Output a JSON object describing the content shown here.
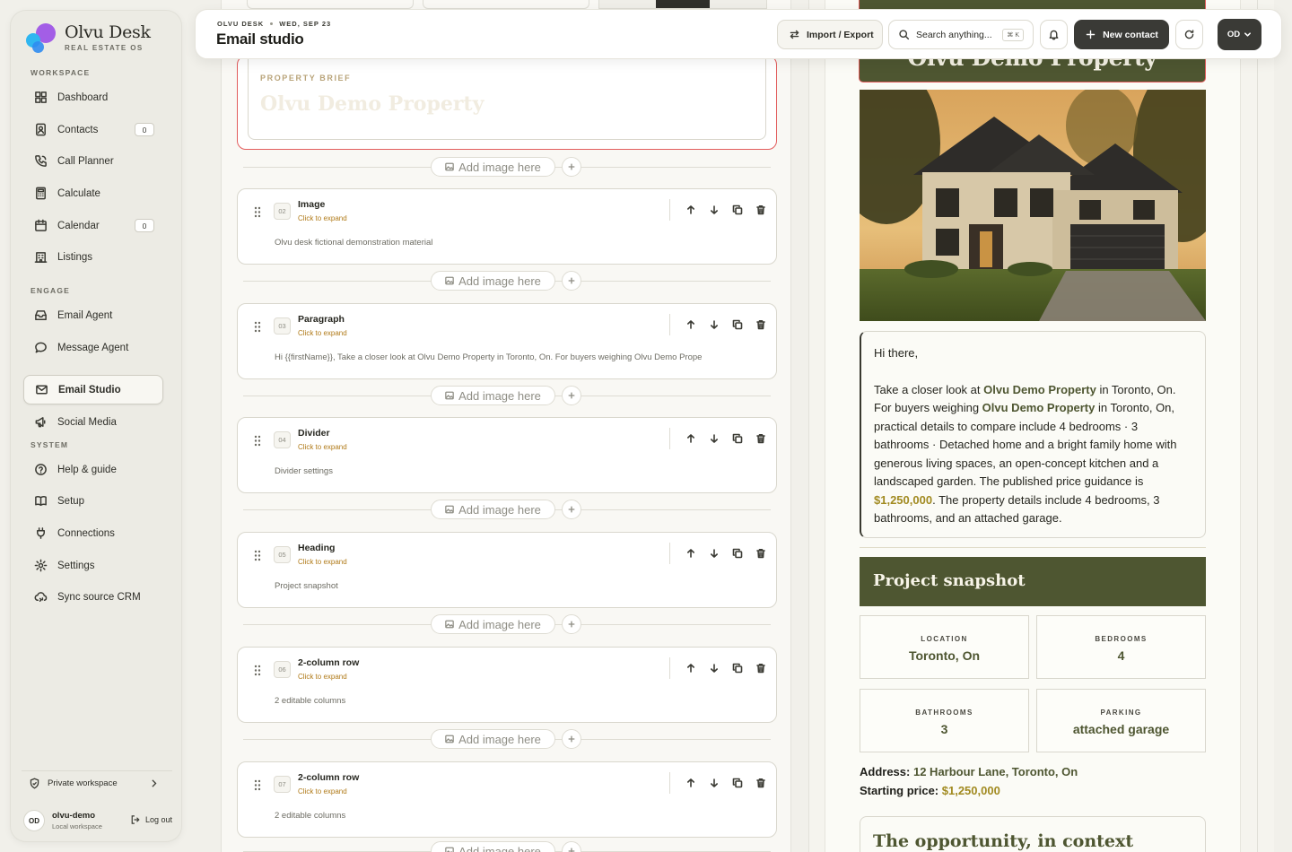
{
  "brand": {
    "name": "Olvu Desk",
    "subtitle": "REAL ESTATE OS"
  },
  "sidebar": {
    "sections": {
      "workspace": "WORKSPACE",
      "engage": "ENGAGE",
      "system": "SYSTEM"
    },
    "items": [
      {
        "label": "Dashboard",
        "icon": "dashboard-icon"
      },
      {
        "label": "Contacts",
        "icon": "contacts-icon",
        "badge": "0"
      },
      {
        "label": "Call Planner",
        "icon": "phone-icon"
      },
      {
        "label": "Calculate",
        "icon": "calculator-icon"
      },
      {
        "label": "Calendar",
        "icon": "calendar-icon",
        "badge": "0"
      },
      {
        "label": "Listings",
        "icon": "building-icon"
      },
      {
        "label": "Email Agent",
        "icon": "inbox-icon"
      },
      {
        "label": "Message Agent",
        "icon": "chat-icon"
      },
      {
        "label": "Email Studio",
        "icon": "mail-icon",
        "active": true
      },
      {
        "label": "Social Media",
        "icon": "megaphone-icon"
      },
      {
        "label": "Help & guide",
        "icon": "help-icon"
      },
      {
        "label": "Setup",
        "icon": "book-icon"
      },
      {
        "label": "Connections",
        "icon": "plug-icon"
      },
      {
        "label": "Settings",
        "icon": "gear-icon"
      },
      {
        "label": "Sync source CRM",
        "icon": "cloud-sync-icon"
      }
    ],
    "private_workspace": "Private workspace",
    "user": {
      "initials": "OD",
      "name": "olvu-demo",
      "sub": "Local workspace"
    },
    "logout": "Log out"
  },
  "topbar": {
    "crumb_app": "OLVU DESK",
    "crumb_date": "WED, SEP 23",
    "title": "Email studio",
    "import_export": "Import / Export",
    "search_placeholder": "Search anything...",
    "search_kbd": "⌘ K",
    "new_contact": "New contact",
    "avatar": "OD"
  },
  "editor": {
    "brief_label": "PROPERTY BRIEF",
    "brief_title": "Olvu Demo Property",
    "insert_label": "Add image here",
    "expand_label": "Click to expand",
    "blocks": [
      {
        "num": "02",
        "title": "Image",
        "desc": "Olvu desk fictional demonstration material"
      },
      {
        "num": "03",
        "title": "Paragraph",
        "desc": "Hi {{firstName}}, Take a closer look at Olvu Demo Property in Toronto, On. For buyers weighing Olvu Demo Prope"
      },
      {
        "num": "04",
        "title": "Divider",
        "desc": "Divider settings"
      },
      {
        "num": "05",
        "title": "Heading",
        "desc": "Project snapshot"
      },
      {
        "num": "06",
        "title": "2-column row",
        "desc": "2 editable columns"
      },
      {
        "num": "07",
        "title": "2-column row",
        "desc": "2 editable columns"
      }
    ]
  },
  "preview": {
    "hero_title": "Olvu Demo Property",
    "greeting": "Hi there,",
    "p_before_name": "Take a closer look at ",
    "property_name": "Olvu Demo Property",
    "p_location1": " in Toronto, On. For buyers weighing ",
    "p_location2": " in Toronto, On, practical details to compare include 4 bedrooms · 3 bathrooms · Detached home and a bright family home with generous living spaces, an open-concept kitchen and a landscaped garden. The published price guidance is ",
    "price": "$1,250,000",
    "p_after_price": ". The property details include 4 bedrooms, 3 bathrooms, and an attached garage.",
    "snapshot_title": "Project snapshot",
    "facts": [
      {
        "label": "LOCATION",
        "value": "Toronto, On"
      },
      {
        "label": "BEDROOMS",
        "value": "4"
      },
      {
        "label": "BATHROOMS",
        "value": "3"
      },
      {
        "label": "PARKING",
        "value": "attached garage"
      }
    ],
    "address_label": "Address:",
    "address_value": "12 Harbour Lane, Toronto, On",
    "price_label": "Starting price:",
    "price_value": "$1,250,000",
    "context_title": "The opportunity, in context"
  },
  "colors": {
    "accent_olive": "#4e5631",
    "price_gold": "#a18a20",
    "expand_link": "#b07a18",
    "selection_red": "#e25c5c"
  }
}
